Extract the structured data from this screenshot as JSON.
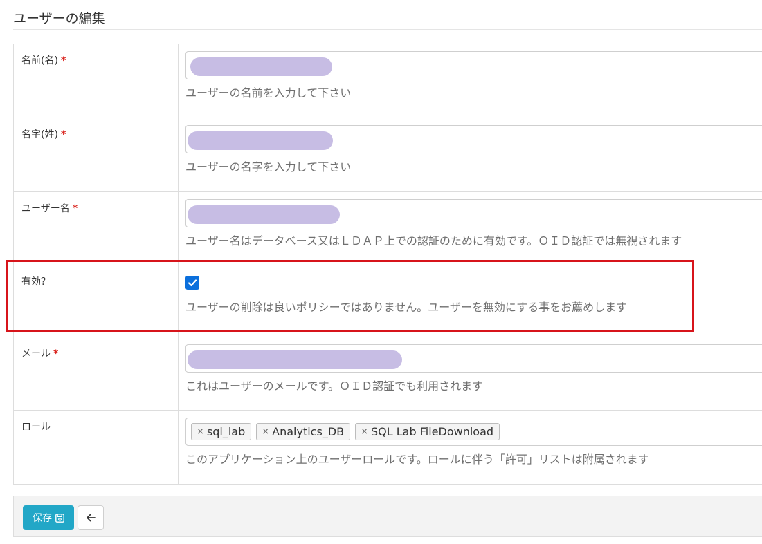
{
  "page": {
    "title": "ユーザーの編集"
  },
  "fields": {
    "first_name": {
      "label": "名前(名)",
      "required_mark": "*",
      "help": "ユーザーの名前を入力して下さい"
    },
    "last_name": {
      "label": "名字(姓)",
      "required_mark": "*",
      "help": "ユーザーの名字を入力して下さい"
    },
    "username": {
      "label": "ユーザー名",
      "required_mark": "*",
      "help": "ユーザー名はデータベース又はＬＤＡＰ上での認証のために有効です。ＯＩＤ認証では無視されます"
    },
    "active": {
      "label": "有効？",
      "checked": true,
      "help": "ユーザーの削除は良いポリシーではありません。ユーザーを無効にする事をお薦めします"
    },
    "email": {
      "label": "メール",
      "required_mark": "*",
      "help": "これはユーザーのメールです。ＯＩＤ認証でも利用されます"
    },
    "roles": {
      "label": "ロール",
      "tags": [
        "sql_lab",
        "Analytics_DB",
        "SQL Lab FileDownload"
      ],
      "remove_glyph": "×",
      "help": "このアプリケーション上のユーザーロールです。ロールに伴う「許可」リストは附属されます"
    }
  },
  "footer": {
    "save_label": "保存",
    "save_icon": "floppy-disk-icon",
    "back_icon": "arrow-left-icon"
  },
  "colors": {
    "required": "#d9231d",
    "save_button": "#22a7c7",
    "highlight": "#d7141b",
    "checkbox": "#0b6fdc",
    "redaction": "#c7bde4"
  }
}
